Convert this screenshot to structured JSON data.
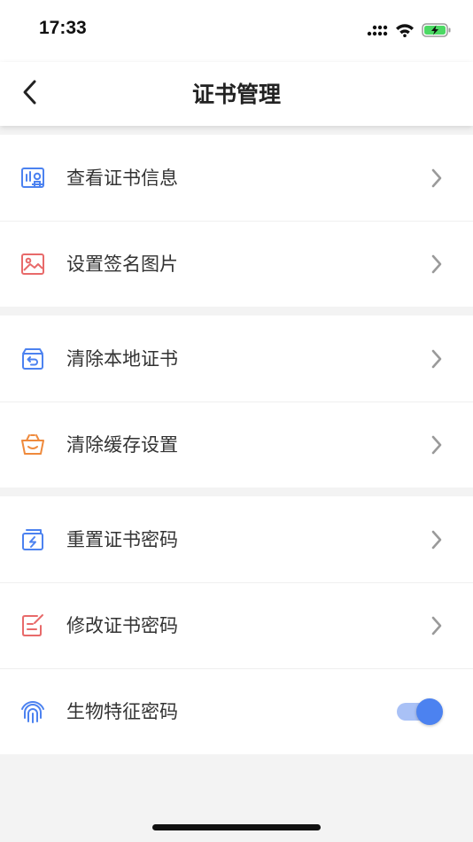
{
  "status_bar": {
    "time": "17:33"
  },
  "header": {
    "title": "证书管理"
  },
  "colors": {
    "blue": "#4c82f0",
    "red": "#e86a6a",
    "orange": "#ef8a3c",
    "chevron": "#9a9a9a"
  },
  "groups": [
    {
      "items": [
        {
          "label": "查看证书信息",
          "icon": "certificate-icon"
        },
        {
          "label": "设置签名图片",
          "icon": "image-icon"
        }
      ]
    },
    {
      "items": [
        {
          "label": "清除本地证书",
          "icon": "box-return-icon"
        },
        {
          "label": "清除缓存设置",
          "icon": "basket-icon"
        }
      ]
    },
    {
      "items": [
        {
          "label": "重置证书密码",
          "icon": "reset-icon"
        },
        {
          "label": "修改证书密码",
          "icon": "edit-icon"
        },
        {
          "label": "生物特征密码",
          "icon": "fingerprint-icon",
          "toggle_on": true
        }
      ]
    }
  ]
}
